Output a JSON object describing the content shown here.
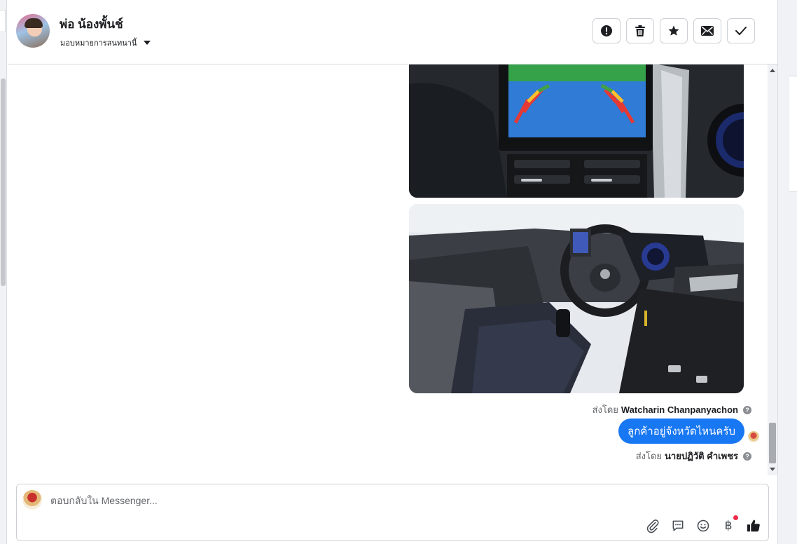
{
  "header": {
    "contact_name": "พ่อ น้องพั้นช์",
    "assign_label": "มอบหมายการสนทนานี้",
    "actions": [
      {
        "name": "spam-icon"
      },
      {
        "name": "trash-icon"
      },
      {
        "name": "star-icon"
      },
      {
        "name": "mark-unread-icon"
      },
      {
        "name": "done-check-icon"
      }
    ]
  },
  "thread": {
    "photos": [
      {
        "name": "dashboard-rear-camera-photo"
      },
      {
        "name": "car-interior-steering-photo"
      }
    ],
    "sent_by_1": {
      "prefix": "ส่งโดย",
      "name": "Watcharin Chanpanyachon"
    },
    "message": "ลูกค้าอยู่จังหวัดไหนครับ",
    "sent_by_2": {
      "prefix": "ส่งโดย",
      "name": "นายปฏิวัติ คำเพชร"
    }
  },
  "composer": {
    "placeholder": "ตอบกลับใน Messenger...",
    "tools": [
      "paperclip-icon",
      "saved-replies-icon",
      "emoji-icon",
      "baht-payment-icon",
      "thumbs-up-icon"
    ],
    "baht_symbol": "฿"
  },
  "colors": {
    "accent": "#1877f2",
    "notification": "#f02849"
  }
}
